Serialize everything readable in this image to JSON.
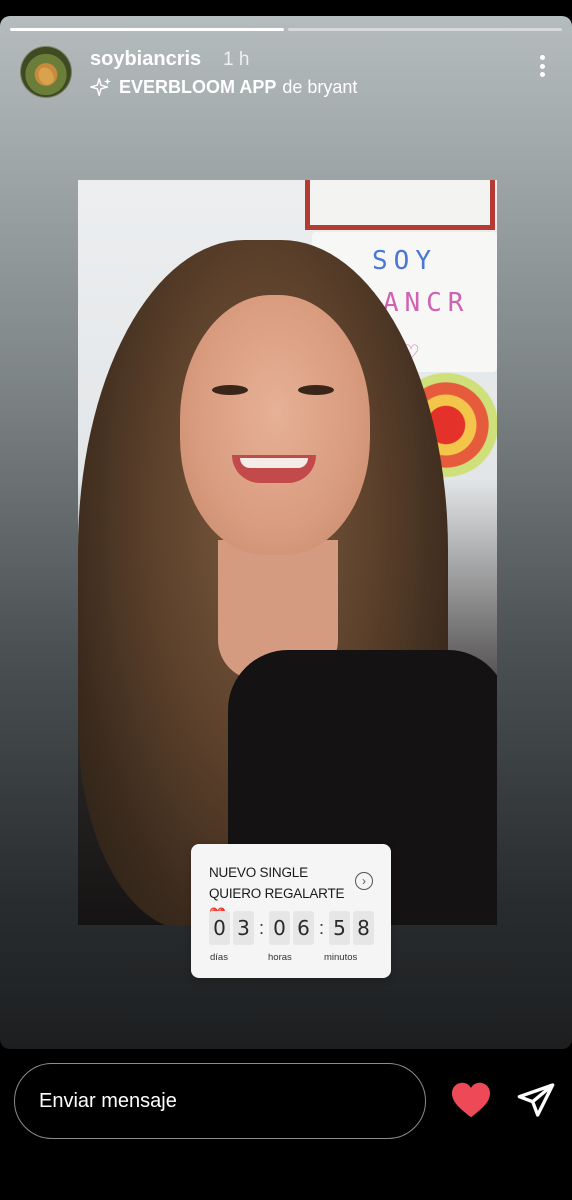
{
  "story": {
    "progress": [
      1.0,
      0.0
    ],
    "username": "soybiancris",
    "time_ago": "1 h",
    "effect_name": "EVERBLOOM APP",
    "effect_author": "de bryant",
    "icons": [
      "sparkle-icon",
      "more-icon",
      "heart-icon",
      "send-icon"
    ]
  },
  "photo": {
    "lightbox_line1": "SOY",
    "lightbox_line2": "BIANCR"
  },
  "countdown": {
    "title": "NUEVO SINGLE QUIERO REGALARTE",
    "title_emoji": "❤️",
    "digits": [
      "0",
      "3",
      "0",
      "6",
      "5",
      "8"
    ],
    "labels": [
      "días",
      "horas",
      "minutos"
    ]
  },
  "footer": {
    "message_placeholder": "Enviar mensaje",
    "accent_heart_color": "#ed4956"
  }
}
